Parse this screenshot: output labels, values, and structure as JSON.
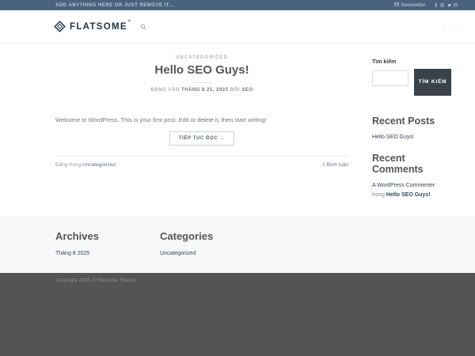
{
  "topbar": {
    "note": "ADD ANYTHING HERE OR JUST REMOVE IT...",
    "newsletter_label": "Newsletter"
  },
  "header": {
    "site_name": "FLATSOME",
    "registered_mark": "®",
    "prev_arrow": "‹",
    "next_arrow": "›"
  },
  "post": {
    "category": "UNCATEGORIZED",
    "title": "Hello SEO Guys!",
    "meta_prefix": "ĐĂNG VÀO",
    "meta_date": "THÁNG 8 25, 2025",
    "meta_by": "BỞI",
    "meta_author": "SEO",
    "excerpt": "Welcome to WordPress. This is your first post. Edit or delete it, then start writing!",
    "read_more_label": "TIẾP TỤC ĐỌC →",
    "posted_in_label": "Đăng trong",
    "posted_in_category": "Uncategorized",
    "comments_label": "1 Bình luận"
  },
  "sidebar": {
    "search_label": "Tìm kiếm",
    "search_button_label": "TÌM KIẾM",
    "recent_posts_title": "Recent Posts",
    "recent_posts": [
      "Hello SEO Guys!"
    ],
    "recent_comments_title": "Recent Comments",
    "recent_comments": [
      {
        "author": "A WordPress Commenter",
        "connector": "trong",
        "post": "Hello SEO Guys!"
      }
    ]
  },
  "footer": {
    "archives_title": "Archives",
    "archives": [
      "Tháng 8 2025"
    ],
    "categories_title": "Categories",
    "categories": [
      "Uncategorized"
    ],
    "copyright": "Copyright 2025 © Flatsome Theme"
  },
  "icons": {
    "topbar": [
      "envelope-icon",
      "facebook-icon",
      "instagram-icon",
      "twitter-icon",
      "email-icon"
    ],
    "header": [
      "gem-logo-icon",
      "search-icon"
    ]
  },
  "colors": {
    "topbar_bg": "#48627f",
    "logo_navy": "#223449",
    "heading_gray": "#555555",
    "body_gray": "#777777",
    "link_blue": "#33475e",
    "search_button_bg": "#39424b",
    "footer_widgets_bg": "#f8f8f8",
    "absolute_footer_bg": "#545457"
  }
}
